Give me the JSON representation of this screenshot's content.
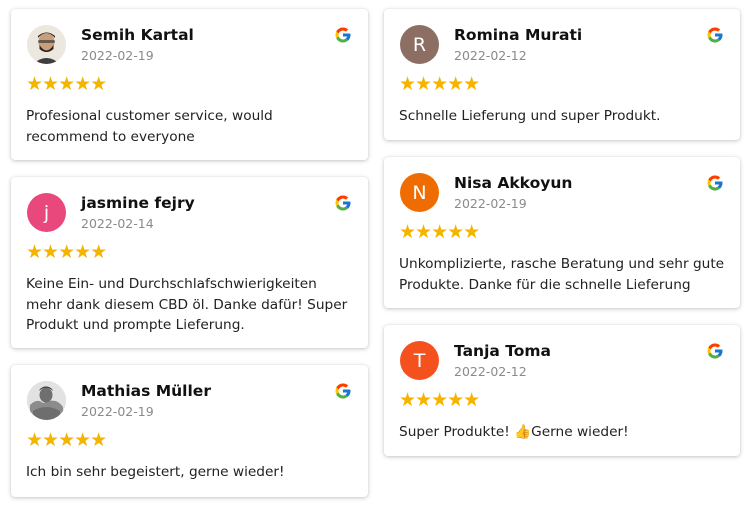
{
  "reviews": [
    {
      "name": "Semih Kartal",
      "date": "2022-02-19",
      "stars": "★★★★★",
      "rating": 5,
      "text": "Profesional customer service, would recommend to everyone",
      "avatar_letter": "",
      "avatar_color": "#c7a98a",
      "avatar_type": "photo"
    },
    {
      "name": "jasmine fejry",
      "date": "2022-02-14",
      "stars": "★★★★★",
      "rating": 5,
      "text": "Keine Ein- und Durchschlafschwierigkeiten mehr dank diesem CBD öl. Danke dafür! Super Produkt und prompte Lieferung.",
      "avatar_letter": "j",
      "avatar_color": "#e8487b",
      "avatar_type": "letter"
    },
    {
      "name": "Mathias Müller",
      "date": "2022-02-19",
      "stars": "★★★★★",
      "rating": 5,
      "text": "Ich bin sehr begeistert, gerne wieder!",
      "avatar_letter": "",
      "avatar_color": "#9a9a9a",
      "avatar_type": "photo"
    },
    {
      "name": "Romina Murati",
      "date": "2022-02-12",
      "stars": "★★★★★",
      "rating": 5,
      "text": "Schnelle Lieferung und super Produkt.",
      "avatar_letter": "R",
      "avatar_color": "#8d6e63",
      "avatar_type": "letter"
    },
    {
      "name": "Nisa Akkoyun",
      "date": "2022-02-19",
      "stars": "★★★★★",
      "rating": 5,
      "text": "Unkomplizierte, rasche Beratung und sehr gute Produkte. Danke für die schnelle Lieferung",
      "avatar_letter": "N",
      "avatar_color": "#ef6c00",
      "avatar_type": "letter"
    },
    {
      "name": "Tanja Toma",
      "date": "2022-02-12",
      "stars": "★★★★★",
      "rating": 5,
      "text": "Super Produkte! 👍Gerne wieder!",
      "avatar_letter": "T",
      "avatar_color": "#f4511e",
      "avatar_type": "letter"
    }
  ],
  "icons": {
    "source": "google-g-icon"
  },
  "colors": {
    "star": "#f5b400",
    "date": "#8a8a8a"
  }
}
